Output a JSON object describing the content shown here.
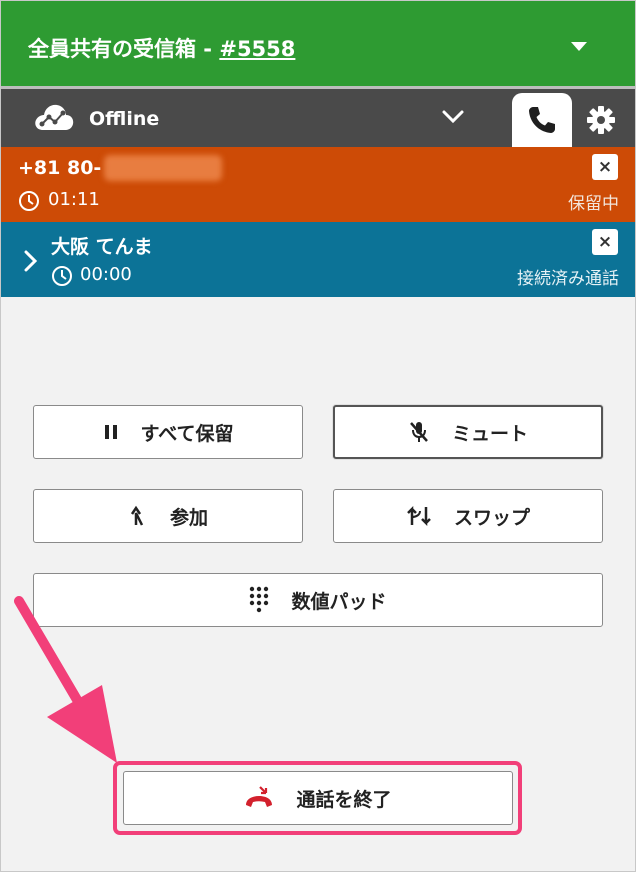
{
  "header": {
    "title_prefix": "全員共有の受信箱 - ",
    "queue_link": "#5558"
  },
  "status_bar": {
    "agent_status": "Offline"
  },
  "calls": [
    {
      "number": "+81 80-",
      "timer": "01:11",
      "state": "保留中",
      "color": "#cd4b06"
    },
    {
      "name": "大阪 てんま",
      "timer": "00:00",
      "state": "接続済み通話",
      "color": "#0c7397"
    }
  ],
  "close_glyph": "×",
  "controls": {
    "hold_all": "すべて保留",
    "mute": "ミュート",
    "join": "参加",
    "swap": "スワップ",
    "keypad": "数値パッド",
    "end_call": "通話を終了"
  },
  "icons": {
    "hold": "pause-icon",
    "mute": "mic-off-icon",
    "join": "merge-icon",
    "swap": "swap-icon",
    "keypad": "dialpad-icon",
    "end_call": "hang-up-icon"
  },
  "colors": {
    "header": "#2e9b32",
    "status_bar": "#4a4a4a",
    "on_hold": "#cd4b06",
    "connected": "#0c7397",
    "highlight": "#f23f79",
    "hangup": "#d3212d"
  }
}
